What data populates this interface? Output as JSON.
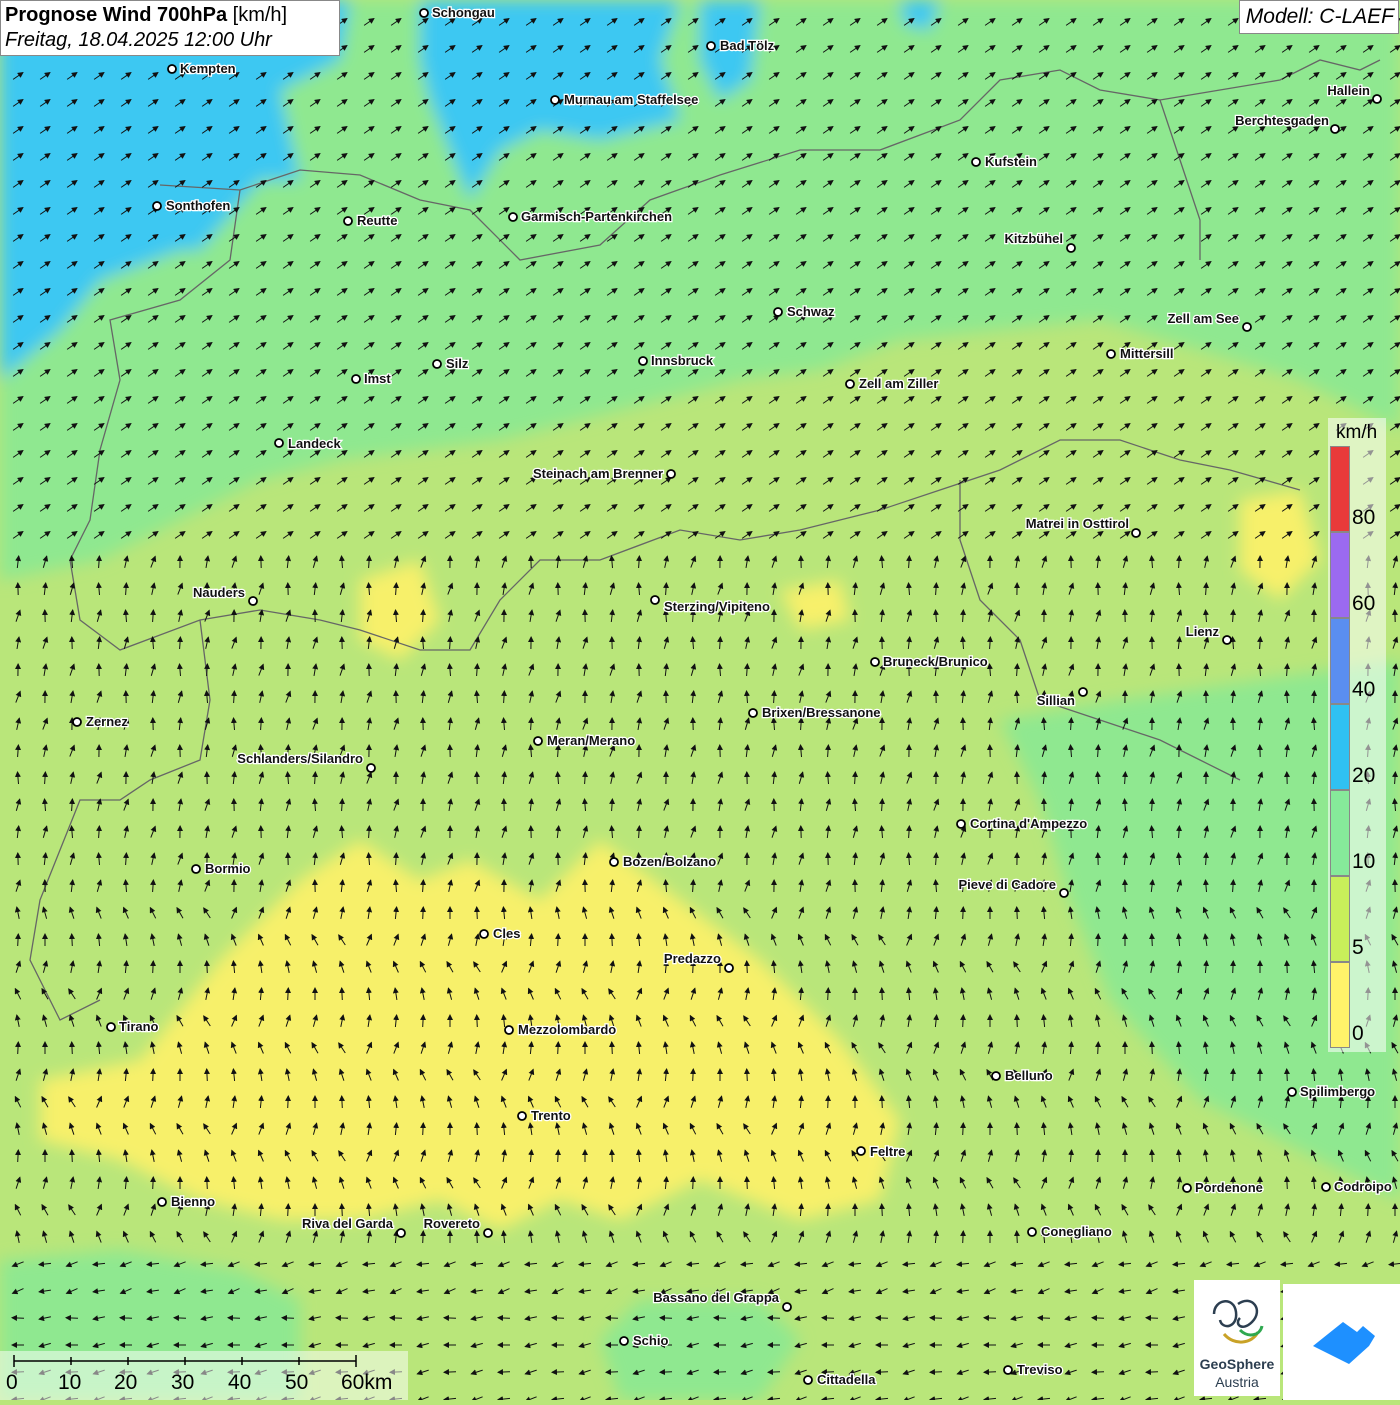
{
  "header": {
    "title_bold": "Prognose Wind 700hPa",
    "title_unit": "[km/h]",
    "subtitle": "Freitag, 18.04.2025 12:00 Uhr",
    "model": "Modell: C-LAEF"
  },
  "legend": {
    "unit": "km/h",
    "labels": [
      "80",
      "60",
      "40",
      "20",
      "10",
      "5",
      "0"
    ],
    "colors": [
      "#e83a3a",
      "#9b6af0",
      "#5a8ef0",
      "#2fc1f2",
      "#86ea9a",
      "#c8ef5a",
      "#fff36a"
    ]
  },
  "scalebar": {
    "labels": [
      "0",
      "10",
      "20",
      "30",
      "40",
      "50",
      "60km"
    ]
  },
  "cities": [
    {
      "name": "Schongau"
    },
    {
      "name": "Bad Tölz"
    },
    {
      "name": "Kempten"
    },
    {
      "name": "Murnau am Staffelsee"
    },
    {
      "name": "Hallein"
    },
    {
      "name": "Berchtesgaden"
    },
    {
      "name": "Kufstein"
    },
    {
      "name": "Sonthofen"
    },
    {
      "name": "Reutte"
    },
    {
      "name": "Garmisch-Partenkirchen"
    },
    {
      "name": "Kitzbühel"
    },
    {
      "name": "Schwaz"
    },
    {
      "name": "Zell am See"
    },
    {
      "name": "Mittersill"
    },
    {
      "name": "Innsbruck"
    },
    {
      "name": "Silz"
    },
    {
      "name": "Imst"
    },
    {
      "name": "Zell am Ziller"
    },
    {
      "name": "Landeck"
    },
    {
      "name": "Steinach am Brenner"
    },
    {
      "name": "Matrei in Osttirol"
    },
    {
      "name": "Nauders"
    },
    {
      "name": "Sterzing/Vipiteno"
    },
    {
      "name": "Lienz"
    },
    {
      "name": "Bruneck/Brunico"
    },
    {
      "name": "Sillian"
    },
    {
      "name": "Brixen/Bressanone"
    },
    {
      "name": "Zernez"
    },
    {
      "name": "Meran/Merano"
    },
    {
      "name": "Schlanders/Silandro"
    },
    {
      "name": "Cortina d'Ampezzo"
    },
    {
      "name": "Bozen/Bolzano"
    },
    {
      "name": "Bormio"
    },
    {
      "name": "Pieve di Cadore"
    },
    {
      "name": "Cles"
    },
    {
      "name": "Predazzo"
    },
    {
      "name": "Tirano"
    },
    {
      "name": "Mezzolombardo"
    },
    {
      "name": "Belluno"
    },
    {
      "name": "Spilimbergo"
    },
    {
      "name": "Trento"
    },
    {
      "name": "Feltre"
    },
    {
      "name": "Bienno"
    },
    {
      "name": "Pordenone"
    },
    {
      "name": "Codroipo"
    },
    {
      "name": "Riva del Garda"
    },
    {
      "name": "Rovereto"
    },
    {
      "name": "Conegliano"
    },
    {
      "name": "Bassano del Grappa"
    },
    {
      "name": "Schio"
    },
    {
      "name": "Treviso"
    },
    {
      "name": "Cittadella"
    }
  ],
  "logo": {
    "name": "GeoSphere",
    "sub": "Austria"
  }
}
